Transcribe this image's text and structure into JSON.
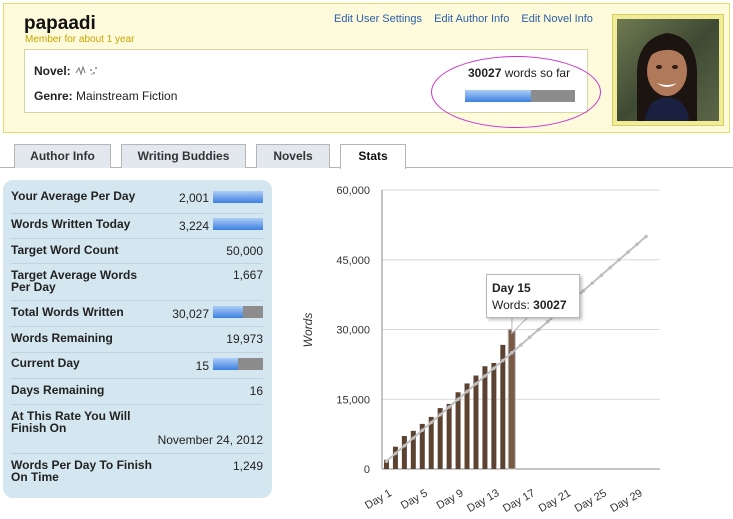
{
  "profile": {
    "username": "papaadi",
    "member_since": "Member for about 1 year",
    "links": [
      "Edit User Settings",
      "Edit Author Info",
      "Edit Novel Info"
    ]
  },
  "novel": {
    "novel_label": "Novel:",
    "genre_label": "Genre:",
    "genre_value": "Mainstream Fiction",
    "words_count": "30027",
    "words_suffix": "words so far",
    "progress_fraction": 0.6,
    "icon": "scribble-icon"
  },
  "tabs": [
    {
      "label": "Author Info",
      "active": false
    },
    {
      "label": "Writing Buddies",
      "active": false
    },
    {
      "label": "Novels",
      "active": false
    },
    {
      "label": "Stats",
      "active": true
    }
  ],
  "stats": [
    {
      "label": "Your Average Per Day",
      "value": "2,001",
      "bar": 1.0
    },
    {
      "label": "Words Written Today",
      "value": "3,224",
      "bar": 1.0
    },
    {
      "label": "Target Word Count",
      "value": "50,000"
    },
    {
      "label": "Target Average Words Per Day",
      "value": "1,667"
    },
    {
      "label": "Total Words Written",
      "value": "30,027",
      "bar": 0.6
    },
    {
      "label": "Words Remaining",
      "value": "19,973"
    },
    {
      "label": "Current Day",
      "value": "15",
      "bar": 0.5
    },
    {
      "label": "Days Remaining",
      "value": "16"
    },
    {
      "label": "At This Rate You Will Finish On",
      "value": "November 24, 2012"
    },
    {
      "label": "Words Per Day To Finish On Time",
      "value": "1,249"
    }
  ],
  "tooltip": {
    "title": "Day 15",
    "label": "Words:",
    "value": "30027"
  },
  "colors": {
    "header_bg": "#fdfbdc",
    "bar": "#5c4230",
    "bar_highlight": "#7a5a44",
    "target_line": "#c0c0c0",
    "progress_blue": "#3d7fe0",
    "progress_gray": "#8c8c8c",
    "panel_bg": "#d4e6ef",
    "link": "#2d5ea5",
    "highlight_ring": "#cc2fd0"
  },
  "chart_data": {
    "type": "bar",
    "ylabel": "Words",
    "ylim": [
      0,
      60000
    ],
    "yticks": [
      "0",
      "15,000",
      "30,000",
      "45,000",
      "60,000"
    ],
    "ytick_values": [
      0,
      15000,
      30000,
      45000,
      60000
    ],
    "xtick_labels": [
      "Day 1",
      "Day 5",
      "Day 9",
      "Day 13",
      "Day 17",
      "Day 21",
      "Day 25",
      "Day 29"
    ],
    "xtick_days": [
      1,
      5,
      9,
      13,
      17,
      21,
      25,
      29
    ],
    "day_count": 30,
    "bars": {
      "days": [
        1,
        2,
        3,
        4,
        5,
        6,
        7,
        8,
        9,
        10,
        11,
        12,
        13,
        14,
        15
      ],
      "values": [
        2000,
        4800,
        7100,
        8200,
        9700,
        11200,
        13100,
        14000,
        16500,
        18400,
        20100,
        22100,
        22800,
        26700,
        30027
      ]
    },
    "target_line": {
      "days": [
        1,
        30
      ],
      "values": [
        1667,
        50000
      ]
    },
    "grid": true,
    "highlighted_day": 15
  }
}
